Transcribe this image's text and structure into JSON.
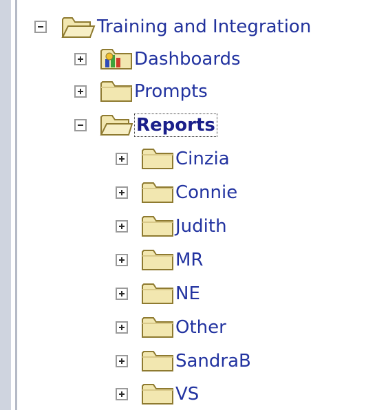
{
  "tree": {
    "root": {
      "label": "Training and Integration",
      "state": "expanded",
      "icon": "folder-open-icon"
    },
    "children": [
      {
        "label": "Dashboards",
        "state": "collapsed",
        "icon": "dashboard-folder-icon"
      },
      {
        "label": "Prompts",
        "state": "collapsed",
        "icon": "folder-icon"
      },
      {
        "label": "Reports",
        "state": "expanded",
        "icon": "folder-open-icon",
        "selected": true
      }
    ],
    "reports_children": [
      {
        "label": "Cinzia",
        "state": "collapsed",
        "icon": "folder-icon"
      },
      {
        "label": "Connie",
        "state": "collapsed",
        "icon": "folder-icon"
      },
      {
        "label": "Judith",
        "state": "collapsed",
        "icon": "folder-icon"
      },
      {
        "label": "MR",
        "state": "collapsed",
        "icon": "folder-icon"
      },
      {
        "label": "NE",
        "state": "collapsed",
        "icon": "folder-icon"
      },
      {
        "label": "Other",
        "state": "collapsed",
        "icon": "folder-icon"
      },
      {
        "label": "SandraB",
        "state": "collapsed",
        "icon": "folder-icon"
      },
      {
        "label": "VS",
        "state": "collapsed",
        "icon": "folder-icon"
      }
    ]
  },
  "colors": {
    "link_text": "#2233a0",
    "folder_fill": "#f2e7b0",
    "folder_stroke": "#a08a3a",
    "sidebar": "#cfd4df"
  }
}
